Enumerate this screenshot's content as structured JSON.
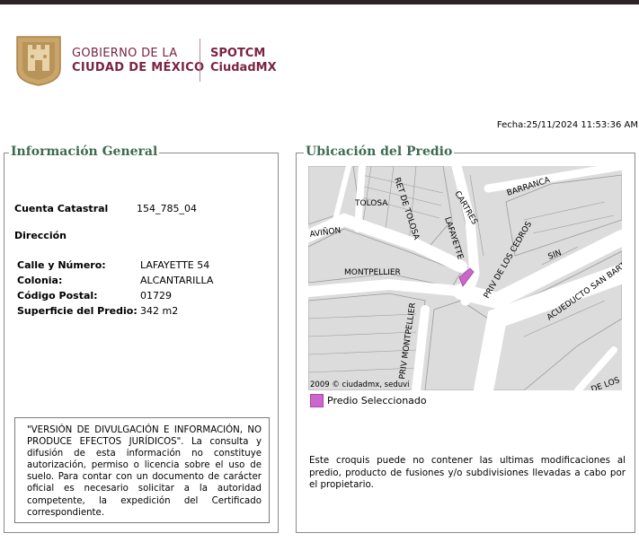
{
  "header": {
    "gov_line1": "GOBIERNO DE LA",
    "gov_line2": "CIUDAD DE MÉXICO",
    "app_line1": "SPOTCM",
    "app_line2": "CiudadMX",
    "brand_color": "#7a2440"
  },
  "fecha": "Fecha:25/11/2024 11:53:36 AM",
  "info_general": {
    "title": "Información General",
    "cuenta_label": "Cuenta Catastral",
    "cuenta_value": "154_785_04",
    "direccion_label": "Dirección",
    "fields": [
      {
        "label": "Calle y Número:",
        "value": "LAFAYETTE 54"
      },
      {
        "label": "Colonia:",
        "value": "ALCANTARILLA"
      },
      {
        "label": "Código Postal:",
        "value": "01729"
      },
      {
        "label": "Superficie del Predio:",
        "value": "342 m2"
      }
    ],
    "notice": "\"VERSIÓN DE DIVULGACIÓN E INFORMACIÓN, NO PRODUCE EFECTOS JURÍDICOS\". La consulta y difusión de esta información no constituye autorización, permiso o licencia sobre el uso de suelo. Para contar con un documento de carácter oficial es necesario solicitar a la autoridad competente, la expedición del Certificado correspondiente."
  },
  "ubicacion": {
    "title": "Ubicación del Predio",
    "map_labels": {
      "cartres": "CARTRES",
      "barranca": "BARRANCA",
      "tolosa": "TOLOSA",
      "ret_tolosa": "RET DE TOLOSA",
      "avinon": "AVIÑON",
      "lafayette": "LAFAYETTE",
      "priv_cedros": "PRIV DE LOS CEDROS",
      "sin": "SIN",
      "acueducto": "ACUEDUCTO SAN BARTO",
      "montpellier": "MONTPELLIER",
      "priv_montpellier": "PRIV MONTPELLIER",
      "de_los": "DE LOS",
      "copyright": "2009 © ciudadmx, seduvi"
    },
    "legend_label": "Predio Seleccionado",
    "predio_color": "#cc66cc",
    "disclaimer": "Este croquis puede no contener las ultimas modificaciones al predio, producto de fusiones y/o subdivisiones llevadas a cabo por el propietario."
  }
}
